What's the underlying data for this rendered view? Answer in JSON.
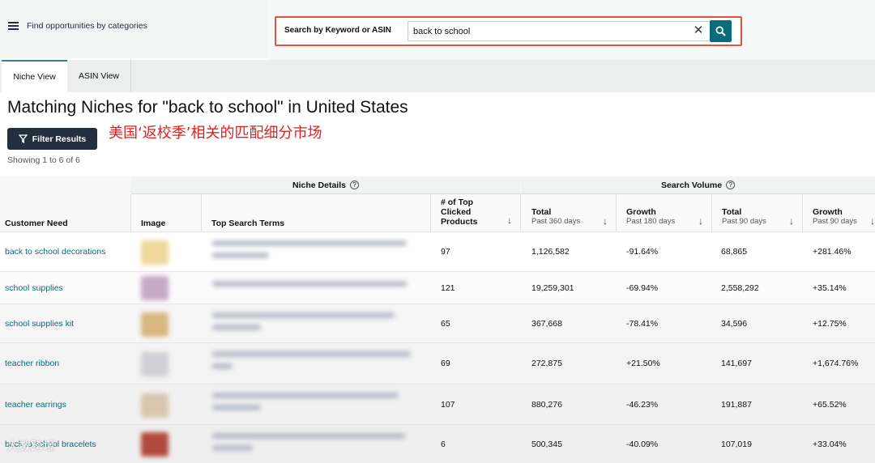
{
  "header": {
    "menu_label": "Find opportunities by categories",
    "search_label": "Search by Keyword or ASIN",
    "search_value": "back to school"
  },
  "tabs": [
    {
      "label": "Niche View",
      "active": true
    },
    {
      "label": "ASIN View",
      "active": false
    }
  ],
  "title": "Matching Niches for \"back to school\" in United States",
  "filter_label": "Filter Results",
  "annotation": "美国‘返校季’相关的匹配细分市场",
  "showing": "Showing 1 to 6 of 6",
  "table": {
    "groups": {
      "niche_details": "Niche Details",
      "search_volume": "Search Volume"
    },
    "columns": {
      "customer_need": "Customer Need",
      "image": "Image",
      "top_search_terms": "Top Search Terms",
      "top_clicked": "# of Top Clicked Products",
      "total_360": "Total",
      "total_360_sub": "Past 360 days",
      "growth_180": "Growth",
      "growth_180_sub": "Past 180 days",
      "total_90": "Total",
      "total_90_sub": "Past 90 days",
      "growth_90": "Growth",
      "growth_90_sub": "Past 90 days"
    },
    "rows": [
      {
        "need": "back to school decorations",
        "clicked": "97",
        "total360": "1,126,582",
        "growth180": "-91.64%",
        "total90": "68,865",
        "growth90": "+281.46%"
      },
      {
        "need": "school supplies",
        "clicked": "121",
        "total360": "19,259,301",
        "growth180": "-69.94%",
        "total90": "2,558,292",
        "growth90": "+35.14%"
      },
      {
        "need": "school supplies kit",
        "clicked": "65",
        "total360": "367,668",
        "growth180": "-78.41%",
        "total90": "34,596",
        "growth90": "+12.75%"
      },
      {
        "need": "teacher ribbon",
        "clicked": "69",
        "total360": "272,875",
        "growth180": "+21.50%",
        "total90": "141,697",
        "growth90": "+1,674.76%"
      },
      {
        "need": "teacher earrings",
        "clicked": "107",
        "total360": "880,276",
        "growth180": "-46.23%",
        "total90": "191,887",
        "growth90": "+65.52%"
      },
      {
        "need": "back to school bracelets",
        "clicked": "6",
        "total360": "500,345",
        "growth180": "-40.09%",
        "total90": "107,019",
        "growth90": "+33.04%"
      }
    ]
  },
  "watermark": "大数跨境",
  "colors": {
    "accent": "#0c6b78",
    "highlight_border": "#e0533c",
    "annotation": "#e02020",
    "dark_button": "#232f3e"
  }
}
